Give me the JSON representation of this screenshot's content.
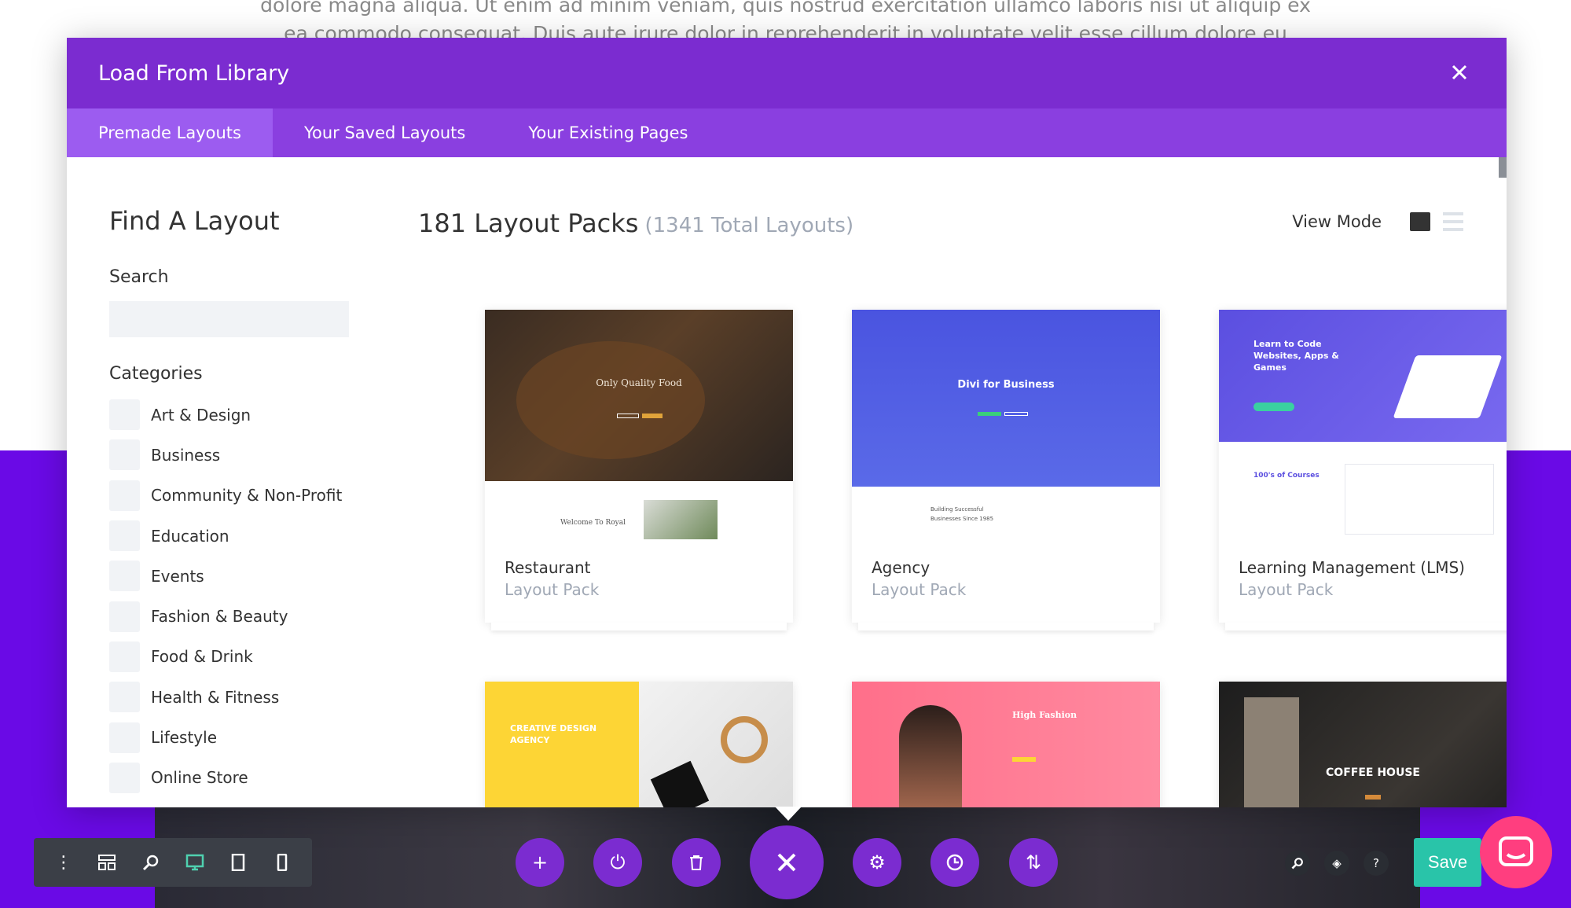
{
  "background": {
    "line1": "dolore magna aliqua. Ut enim ad minim veniam, quis nostrud exercitation ullamco laboris nisi ut aliquip ex",
    "line2": "ea commodo consequat. Duis aute irure dolor in reprehenderit in voluptate velit esse cillum dolore eu"
  },
  "modal": {
    "title": "Load From Library",
    "close_icon": "close-icon",
    "tabs": [
      {
        "label": "Premade Layouts",
        "active": true
      },
      {
        "label": "Your Saved Layouts",
        "active": false
      },
      {
        "label": "Your Existing Pages",
        "active": false
      }
    ]
  },
  "sidebar": {
    "title": "Find A Layout",
    "search_label": "Search",
    "search_value": "",
    "categories_label": "Categories",
    "categories": [
      "Art & Design",
      "Business",
      "Community & Non-Profit",
      "Education",
      "Events",
      "Fashion & Beauty",
      "Food & Drink",
      "Health & Fitness",
      "Lifestyle",
      "Online Store"
    ]
  },
  "main": {
    "packs_title": "181 Layout Packs",
    "packs_sub": "(1341 Total Layouts)",
    "view_mode_label": "View Mode",
    "cards": [
      {
        "title": "Restaurant",
        "subtitle": "Layout Pack",
        "thumb_text": "Only Quality Food",
        "thumb_text2": "Welcome To Royal"
      },
      {
        "title": "Agency",
        "subtitle": "Layout Pack",
        "thumb_text": "Divi for Business",
        "thumb_text2": "Building Successful Businesses Since 1985"
      },
      {
        "title": "Learning Management (LMS)",
        "subtitle": "Layout Pack",
        "thumb_text": "Learn to Code Websites, Apps & Games",
        "thumb_text2": "100's of Courses"
      }
    ],
    "cards_row2": [
      {
        "thumb_text": "CREATIVE DESIGN AGENCY"
      },
      {
        "thumb_text": "High Fashion"
      },
      {
        "thumb_text": "COFFEE HOUSE"
      }
    ]
  },
  "toolbar": {
    "save_label": "Save",
    "colors": {
      "purple": "#7b2cd0",
      "save": "#29c4a9",
      "chat": "#ff3e7f",
      "active_device": "#4fd1b0"
    }
  }
}
